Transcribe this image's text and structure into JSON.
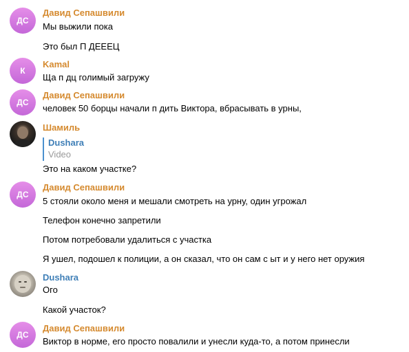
{
  "messages": [
    {
      "sender": "Давид Сепашвили",
      "avatar_initials": "ДС",
      "sender_color": "#d58a2f",
      "lines": [
        "Мы выжили пока",
        "Это был П     ДЕЕЕЦ"
      ]
    },
    {
      "sender": "Kamal",
      "avatar_initials": "К",
      "sender_color": "#d58a2f",
      "lines": [
        "Ща п   дц голимый загружу"
      ]
    },
    {
      "sender": "Давид Сепашвили",
      "avatar_initials": "ДС",
      "sender_color": "#d58a2f",
      "lines": [
        "человек 50 борцы начали п     дить Виктора, вбрасывать в урны,"
      ]
    },
    {
      "sender": "Шамиль",
      "avatar_icon": "person-photo-icon",
      "sender_color": "#d58a2f",
      "reply": {
        "name": "Dushara",
        "media": "Video"
      },
      "lines": [
        "Это на каком участке?"
      ]
    },
    {
      "sender": "Давид Сепашвили",
      "avatar_initials": "ДС",
      "sender_color": "#d58a2f",
      "lines": [
        "5 стояли около меня и мешали смотреть на урну, один угрожал",
        "Телефон конечно запретили",
        "Потом потребовали удалиться с участка",
        "Я ушел, подошел к полиции, а он сказал, что он сам с  ыт и у него нет оружия"
      ]
    },
    {
      "sender": "Dushara",
      "avatar_icon": "statue-photo-icon",
      "sender_color": "#3f7fb7",
      "lines": [
        "Ого",
        "Какой участок?"
      ]
    },
    {
      "sender": "Давид Сепашвили",
      "avatar_initials": "ДС",
      "sender_color": "#d58a2f",
      "lines": [
        "Виктор в норме, его просто повалили и унесли куда-то, а потом принесли"
      ]
    }
  ]
}
